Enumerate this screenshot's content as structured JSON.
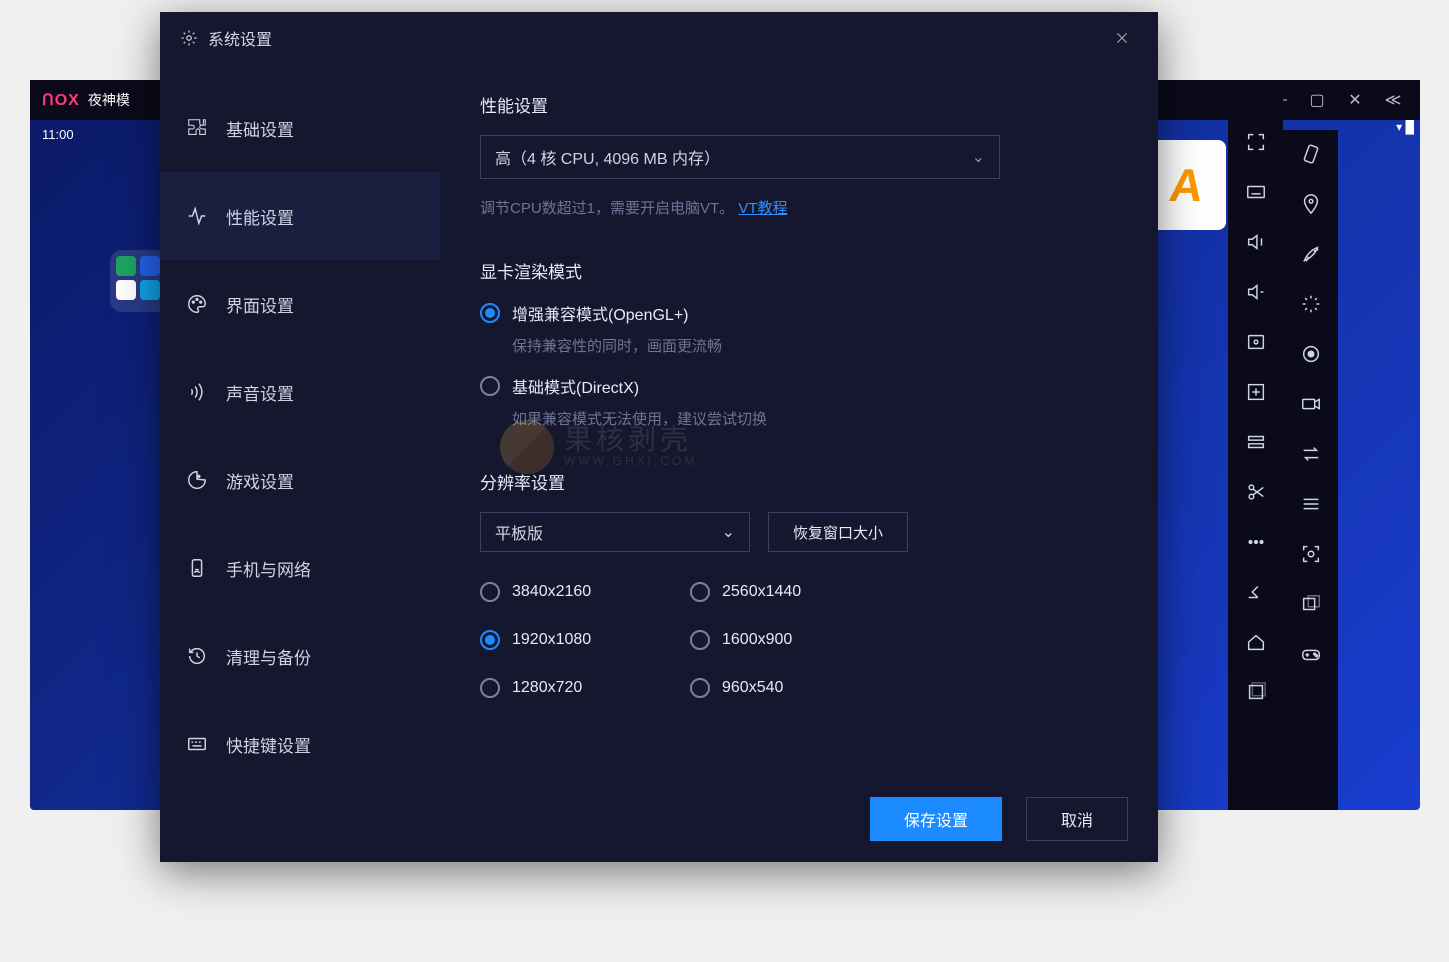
{
  "bg": {
    "logo": "ᑎOX",
    "title": "夜神模",
    "clock": "11:00"
  },
  "dialog": {
    "title": "系统设置"
  },
  "sidebar": {
    "items": [
      {
        "label": "基础设置"
      },
      {
        "label": "性能设置"
      },
      {
        "label": "界面设置"
      },
      {
        "label": "声音设置"
      },
      {
        "label": "游戏设置"
      },
      {
        "label": "手机与网络"
      },
      {
        "label": "清理与备份"
      },
      {
        "label": "快捷键设置"
      }
    ]
  },
  "perf": {
    "heading": "性能设置",
    "preset": "高（4 核 CPU, 4096 MB 内存）",
    "hint_prefix": "调节CPU数超过1，需要开启电脑VT。",
    "hint_link": "VT教程"
  },
  "render": {
    "heading": "显卡渲染模式",
    "opt1": "增强兼容模式(OpenGL+)",
    "opt1_hint": "保持兼容性的同时，画面更流畅",
    "opt2": "基础模式(DirectX)",
    "opt2_hint": "如果兼容模式无法使用，建议尝试切换"
  },
  "res": {
    "heading": "分辨率设置",
    "mode": "平板版",
    "restore": "恢复窗口大小",
    "options": [
      "3840x2160",
      "2560x1440",
      "1920x1080",
      "1600x900",
      "1280x720",
      "960x540"
    ]
  },
  "footer": {
    "save": "保存设置",
    "cancel": "取消"
  },
  "watermark": {
    "name": "果核剥壳",
    "url": "WWW.GHXI.COM"
  }
}
